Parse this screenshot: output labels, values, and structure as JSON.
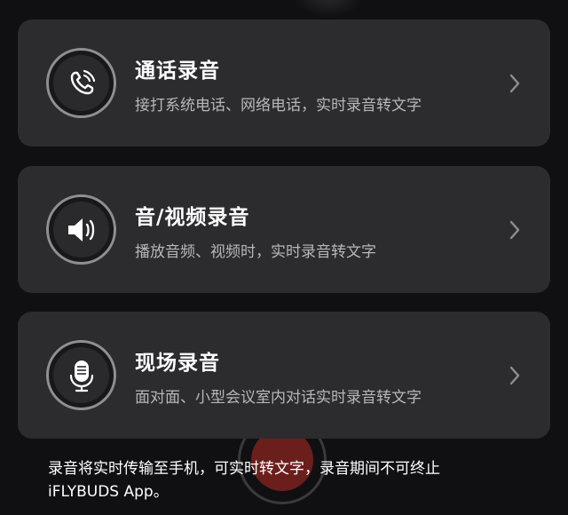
{
  "cards": [
    {
      "title": "通话录音",
      "description": "接打系统电话、网络电话，实时录音转文字",
      "icon": "phone-call-icon"
    },
    {
      "title": "音/视频录音",
      "description": "播放音频、视频时，实时录音转文字",
      "icon": "speaker-icon"
    },
    {
      "title": "现场录音",
      "description": "面对面、小型会议室内对话实时录音转文字",
      "icon": "microphone-icon"
    }
  ],
  "footer": {
    "line1": "录音将实时传输至手机，可实时转文字，录音期间不可终止",
    "line2": "iFLYBUDS App。"
  },
  "colors": {
    "background": "#101012",
    "card": "#2c2c2f",
    "title": "#ffffff",
    "description": "#b7b7bb",
    "icon_ring": "#8e8e93",
    "chevron": "#8e8e93"
  }
}
